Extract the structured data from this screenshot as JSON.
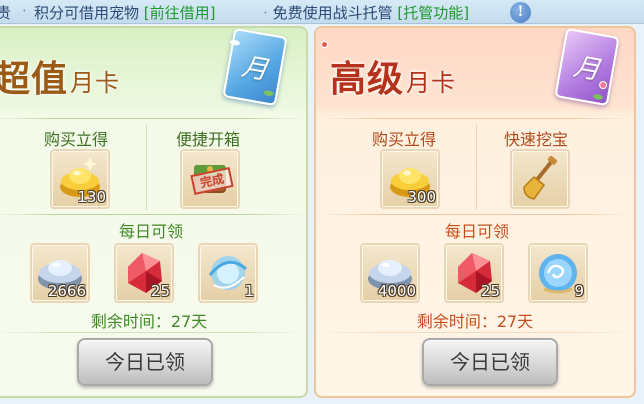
{
  "topbar": {
    "truncated_left": "贵",
    "item1_text": "积分可借用宠物",
    "item1_link": "[前往借用]",
    "item2_text": "免费使用战斗托管",
    "item2_link": "[托管功能]",
    "info_icon": "!"
  },
  "cards": [
    {
      "title_main": "超值",
      "title_small": "月卡",
      "badge_char": "月",
      "instant_label": "购买立得",
      "perk_label": "便捷开箱",
      "instant_item": {
        "icon": "gold-ingot-icon",
        "qty": "130"
      },
      "perk_item": {
        "icon": "treasure-box-icon",
        "stamp": "完成"
      },
      "daily_label": "每日可领",
      "daily_items": [
        {
          "icon": "silver-ingot-icon",
          "qty": "2666"
        },
        {
          "icon": "red-gem-icon",
          "qty": "25"
        },
        {
          "icon": "blue-orb-icon",
          "qty": "1"
        }
      ],
      "remaining": "剩余时间：27天",
      "button": "今日已领"
    },
    {
      "title_main": "高级",
      "title_small": "月卡",
      "badge_char": "月",
      "instant_label": "购买立得",
      "perk_label": "快速挖宝",
      "instant_item": {
        "icon": "gold-ingot-icon",
        "qty": "300"
      },
      "perk_item": {
        "icon": "shovel-icon"
      },
      "daily_label": "每日可领",
      "daily_items": [
        {
          "icon": "silver-ingot-icon",
          "qty": "4000"
        },
        {
          "icon": "red-gem-icon",
          "qty": "25"
        },
        {
          "icon": "swirl-orb-icon",
          "qty": "9"
        }
      ],
      "remaining": "剩余时间：27天",
      "button": "今日已领"
    }
  ],
  "colors": {
    "green_title": "#9b5b17",
    "orange_title": "#b5331c",
    "link_green": "#1f9a2c"
  }
}
